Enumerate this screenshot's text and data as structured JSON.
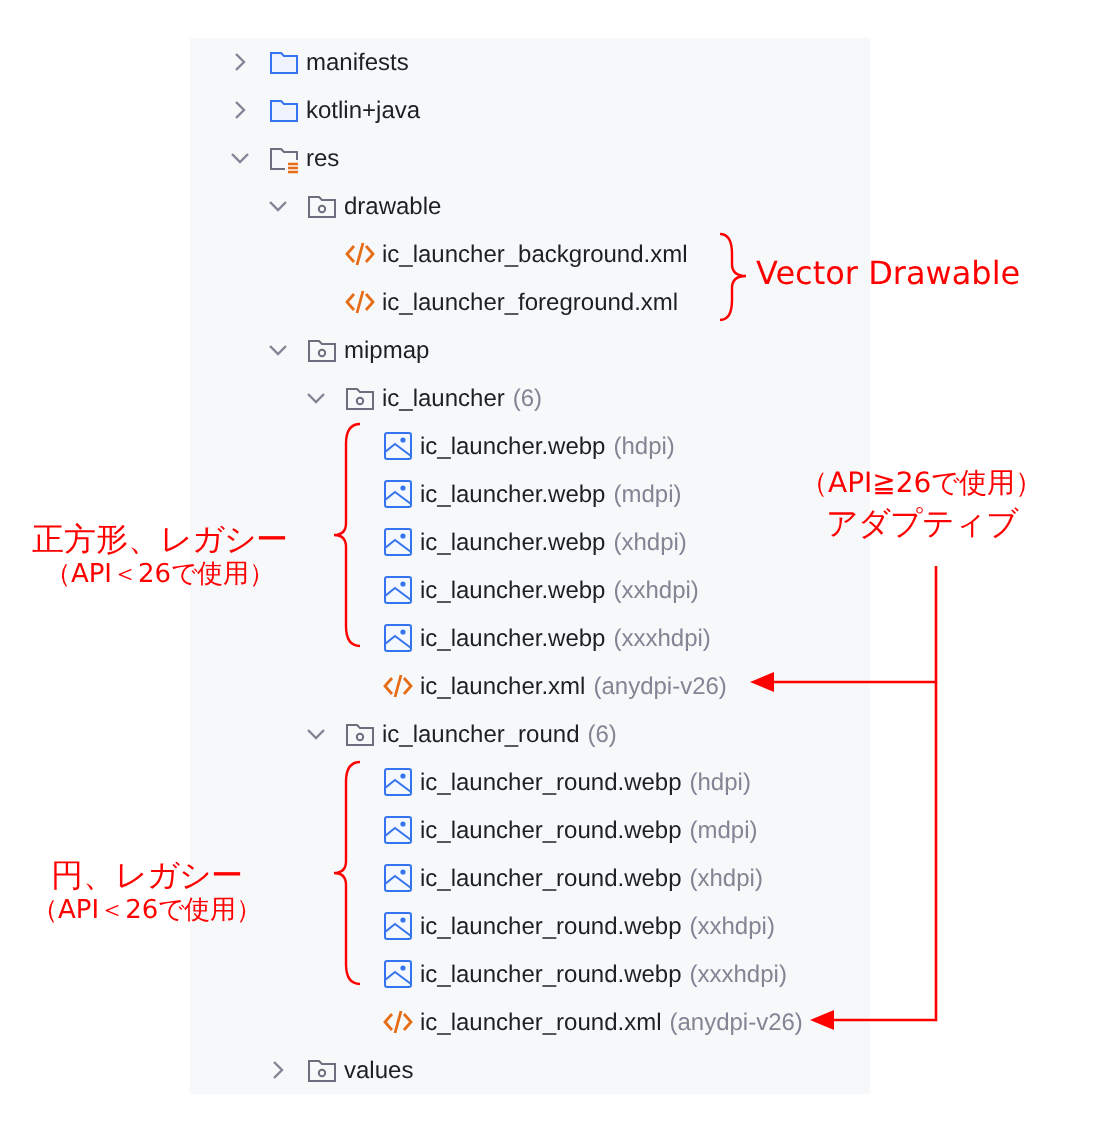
{
  "tree": [
    {
      "name": "manifests",
      "kind": "source-folder",
      "expanded": false
    },
    {
      "name": "kotlin+java",
      "kind": "source-folder",
      "expanded": false
    },
    {
      "name": "res",
      "kind": "res-folder",
      "expanded": true,
      "children": [
        {
          "name": "drawable",
          "kind": "folder",
          "expanded": true,
          "children": [
            {
              "name": "ic_launcher_background.xml",
              "kind": "xml"
            },
            {
              "name": "ic_launcher_foreground.xml",
              "kind": "xml"
            }
          ]
        },
        {
          "name": "mipmap",
          "kind": "folder",
          "expanded": true,
          "children": [
            {
              "name": "ic_launcher",
              "count": "(6)",
              "kind": "folder",
              "expanded": true,
              "children": [
                {
                  "name": "ic_launcher.webp",
                  "qualifier": "(hdpi)",
                  "kind": "image"
                },
                {
                  "name": "ic_launcher.webp",
                  "qualifier": "(mdpi)",
                  "kind": "image"
                },
                {
                  "name": "ic_launcher.webp",
                  "qualifier": "(xhdpi)",
                  "kind": "image"
                },
                {
                  "name": "ic_launcher.webp",
                  "qualifier": "(xxhdpi)",
                  "kind": "image"
                },
                {
                  "name": "ic_launcher.webp",
                  "qualifier": "(xxxhdpi)",
                  "kind": "image"
                },
                {
                  "name": "ic_launcher.xml",
                  "qualifier": "(anydpi-v26)",
                  "kind": "xml"
                }
              ]
            },
            {
              "name": "ic_launcher_round",
              "count": "(6)",
              "kind": "folder",
              "expanded": true,
              "children": [
                {
                  "name": "ic_launcher_round.webp",
                  "qualifier": "(hdpi)",
                  "kind": "image"
                },
                {
                  "name": "ic_launcher_round.webp",
                  "qualifier": "(mdpi)",
                  "kind": "image"
                },
                {
                  "name": "ic_launcher_round.webp",
                  "qualifier": "(xhdpi)",
                  "kind": "image"
                },
                {
                  "name": "ic_launcher_round.webp",
                  "qualifier": "(xxhdpi)",
                  "kind": "image"
                },
                {
                  "name": "ic_launcher_round.webp",
                  "qualifier": "(xxxhdpi)",
                  "kind": "image"
                },
                {
                  "name": "ic_launcher_round.xml",
                  "qualifier": "(anydpi-v26)",
                  "kind": "xml"
                }
              ]
            }
          ]
        },
        {
          "name": "values",
          "kind": "folder",
          "expanded": false
        }
      ]
    }
  ],
  "annotations": [
    {
      "lines": [
        "Vector Drawable"
      ]
    },
    {
      "lines": [
        "正方形、レガシー",
        "（API＜26で使用）"
      ]
    },
    {
      "lines": [
        "（API≧26で使用）",
        "アダプティブ"
      ]
    },
    {
      "lines": [
        "円、レガシー",
        "（API＜26で使用）"
      ]
    }
  ]
}
